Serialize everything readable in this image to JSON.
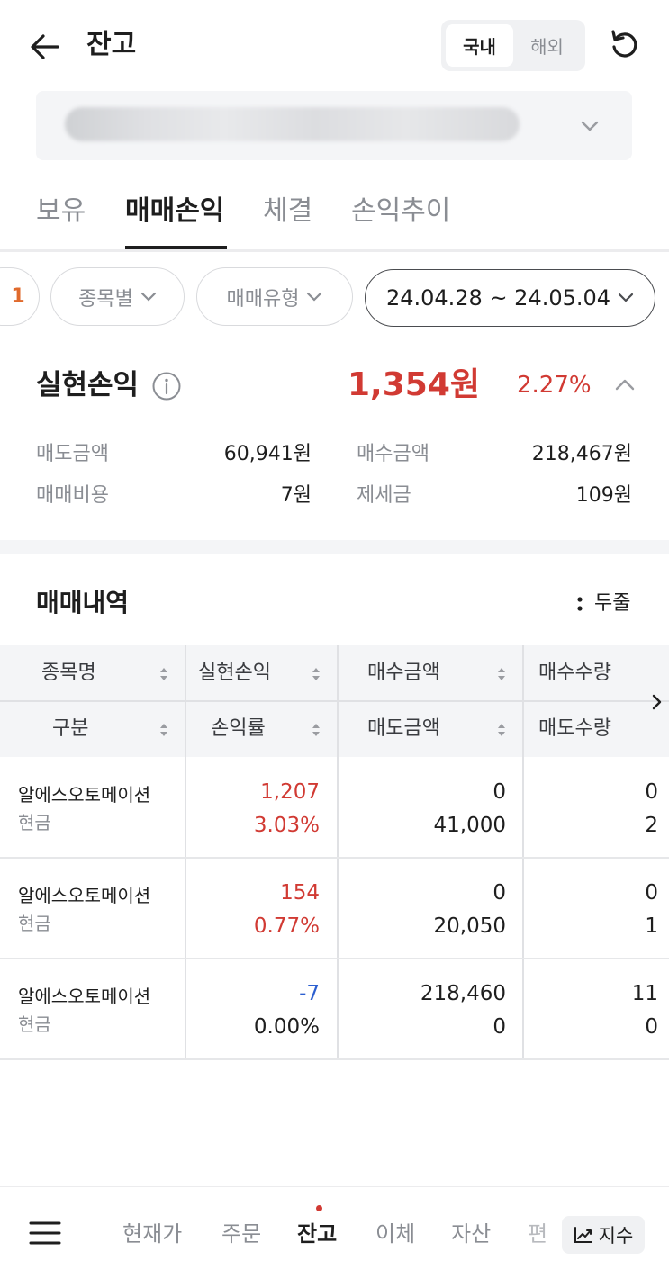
{
  "header": {
    "title": "잔고",
    "market_tabs": [
      "국내",
      "해외"
    ],
    "active_market": 0
  },
  "tabs": {
    "items": [
      "보유",
      "매매손익",
      "체결",
      "손익추이"
    ],
    "active": 1
  },
  "filters": {
    "count": "1",
    "by_stock": "종목별",
    "trade_type": "매매유형",
    "date_range": "24.04.28 ~ 24.05.04"
  },
  "summary": {
    "title": "실현손익",
    "amount": "1,354원",
    "rate": "2.27%",
    "rows": [
      {
        "label": "매도금액",
        "value": "60,941원"
      },
      {
        "label": "매수금액",
        "value": "218,467원"
      },
      {
        "label": "매매비용",
        "value": "7원"
      },
      {
        "label": "제세금",
        "value": "109원"
      }
    ]
  },
  "trades": {
    "title": "매매내역",
    "view_toggle": "두줄",
    "headers": {
      "row1": [
        "종목명",
        "실현손익",
        "매수금액",
        "매수수량"
      ],
      "row2": [
        "구분",
        "손익률",
        "매도금액",
        "매도수량"
      ]
    },
    "rows": [
      {
        "name": "알에스오토메이션",
        "type": "현금",
        "pnl": "1,207",
        "rate": "3.03%",
        "buy_amt": "0",
        "sell_amt": "41,000",
        "buy_qty": "0",
        "sell_qty": "2",
        "tone": "red"
      },
      {
        "name": "알에스오토메이션",
        "type": "현금",
        "pnl": "154",
        "rate": "0.77%",
        "buy_amt": "0",
        "sell_amt": "20,050",
        "buy_qty": "0",
        "sell_qty": "1",
        "tone": "red"
      },
      {
        "name": "알에스오토메이션",
        "type": "현금",
        "pnl": "-7",
        "rate": "0.00%",
        "buy_amt": "218,460",
        "sell_amt": "0",
        "buy_qty": "11",
        "sell_qty": "0",
        "tone": "blue"
      }
    ]
  },
  "bottom_nav": {
    "items": [
      "현재가",
      "주문",
      "잔고",
      "이체",
      "자산",
      "편"
    ],
    "active": 2,
    "index_label": "지수"
  },
  "colors": {
    "profit": "#d13a33",
    "loss": "#2c5fd0",
    "accent_orange": "#e06a2c"
  }
}
